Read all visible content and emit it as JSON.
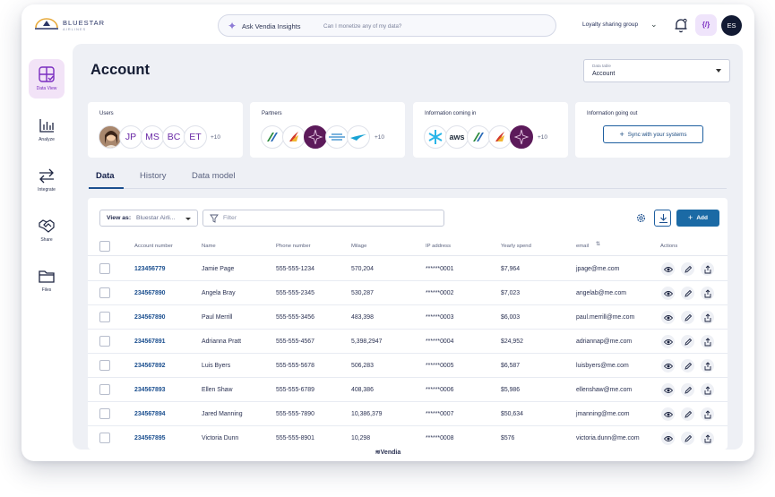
{
  "brand": {
    "name": "BLUESTAR",
    "sub": "AIRLINES"
  },
  "ask": {
    "label": "Ask Vendia Insights",
    "prompt": "Can I monetize any of my data?"
  },
  "group_selector": {
    "label": "Loyalty sharing group"
  },
  "code_button": {
    "label": "{/}"
  },
  "user": {
    "initials": "ES"
  },
  "sidebar": {
    "items": [
      {
        "label": "Data View",
        "icon": "data-view-icon",
        "active": true
      },
      {
        "label": "Analyze",
        "icon": "bar-chart-icon",
        "active": false
      },
      {
        "label": "Integrate",
        "icon": "arrows-icon",
        "active": false
      },
      {
        "label": "Share",
        "icon": "handshake-icon",
        "active": false
      },
      {
        "label": "Files",
        "icon": "folder-icon",
        "active": false
      }
    ]
  },
  "page": {
    "title": "Account",
    "data_table": {
      "label": "Data table",
      "value": "Account"
    }
  },
  "cards": {
    "users": {
      "title": "Users",
      "initials": [
        "JP",
        "MS",
        "BC",
        "ET"
      ],
      "more": "+10"
    },
    "partners": {
      "title": "Partners",
      "more": "+10"
    },
    "info_in": {
      "title": "Information coming in",
      "aws": "aws",
      "more": "+10"
    },
    "info_out": {
      "title": "Information going out",
      "button": "Sync with your systems"
    }
  },
  "tabs": [
    "Data",
    "History",
    "Data model"
  ],
  "toolbar": {
    "view_as_key": "View as:",
    "view_as_value": "Bluestar Airli...",
    "filter_placeholder": "Filter",
    "add_label": "Add"
  },
  "table": {
    "columns": [
      "Account number",
      "Name",
      "Phone number",
      "Milage",
      "IP address",
      "Yearly spend",
      "email",
      "Actions"
    ],
    "sort_glyph": "⇅",
    "rows": [
      [
        "123456779",
        "Jamie Page",
        "555-555-1234",
        "570,204",
        "******0001",
        "$7,964",
        "jpage@me.com"
      ],
      [
        "234567890",
        "Angela Bray",
        "555-555-2345",
        "530,287",
        "******0002",
        "$7,023",
        "angelab@me.com"
      ],
      [
        "234567890",
        "Paul Merrill",
        "555-555-3456",
        "483,398",
        "******0003",
        "$6,003",
        "paul.merrill@me.com"
      ],
      [
        "234567891",
        "Adrianna Pratt",
        "555-555-4567",
        "5,398,2947",
        "******0004",
        "$24,952",
        "adriannap@me.com"
      ],
      [
        "234567892",
        "Luis Byers",
        "555-555-5678",
        "506,283",
        "******0005",
        "$6,587",
        "luisbyers@me.com"
      ],
      [
        "234567893",
        "Ellen Shaw",
        "555-555-6789",
        "408,386",
        "******0006",
        "$5,986",
        "ellenshaw@me.com"
      ],
      [
        "234567894",
        "Jared Manning",
        "555-555-7890",
        "10,386,379",
        "******0007",
        "$50,634",
        "jmanning@me.com"
      ],
      [
        "234567895",
        "Victoria Dunn",
        "555-555-8901",
        "10,298",
        "******0008",
        "$576",
        "victoria.dunn@me.com"
      ]
    ]
  },
  "footer": {
    "label": "≋Vendia"
  }
}
